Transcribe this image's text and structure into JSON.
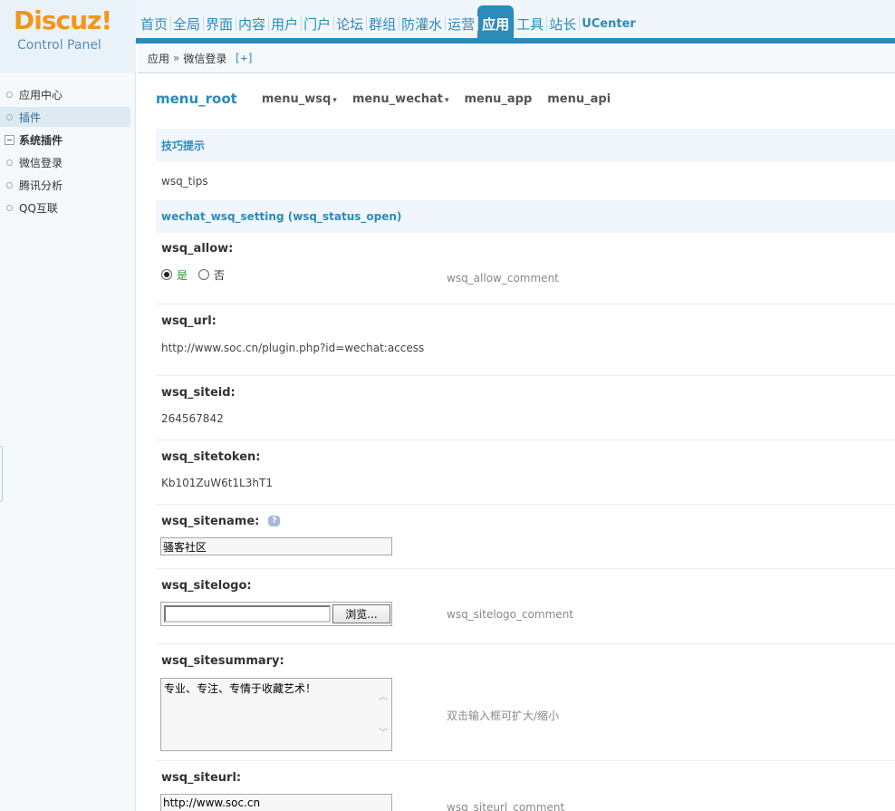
{
  "logo": {
    "brand": "Discuz!",
    "subtitle": "Control Panel"
  },
  "topnav": [
    {
      "label": "首页"
    },
    {
      "label": "全局"
    },
    {
      "label": "界面"
    },
    {
      "label": "内容"
    },
    {
      "label": "用户"
    },
    {
      "label": "门户"
    },
    {
      "label": "论坛"
    },
    {
      "label": "群组"
    },
    {
      "label": "防灌水"
    },
    {
      "label": "运营"
    },
    {
      "label": "应用",
      "active": true
    },
    {
      "label": "工具"
    },
    {
      "label": "站长"
    },
    {
      "label": "UCenter"
    }
  ],
  "breadcrumb": {
    "root": "应用",
    "sep": "»",
    "current": "微信登录",
    "plus": "[+]"
  },
  "sidebar": {
    "items": [
      {
        "label": "应用中心"
      },
      {
        "label": "插件",
        "selected": true
      }
    ],
    "group": "系统插件",
    "group_items": [
      {
        "label": "微信登录"
      },
      {
        "label": "腾讯分析"
      },
      {
        "label": "QQ互联"
      }
    ]
  },
  "submenu": {
    "root": "menu_root",
    "items": [
      {
        "label": "menu_wsq",
        "dropdown": "▾"
      },
      {
        "label": "menu_wechat",
        "dropdown": "▾"
      },
      {
        "label": "menu_app"
      },
      {
        "label": "menu_api"
      }
    ]
  },
  "tips": {
    "title": "技巧提示",
    "text": "wsq_tips"
  },
  "settings": {
    "title": "wechat_wsq_setting (wsq_status_open)",
    "wsq_allow": {
      "label": "wsq_allow:",
      "yes": "是",
      "no": "否",
      "selected": "是",
      "comment": "wsq_allow_comment"
    },
    "wsq_url": {
      "label": "wsq_url:",
      "value": "http://www.soc.cn/plugin.php?id=wechat:access"
    },
    "wsq_siteid": {
      "label": "wsq_siteid:",
      "value": "264567842"
    },
    "wsq_sitetoken": {
      "label": "wsq_sitetoken:",
      "value": "Kb101ZuW6t1L3hT1"
    },
    "wsq_sitename": {
      "label": "wsq_sitename:",
      "value": "骚客社区",
      "help_icon": "question-icon"
    },
    "wsq_sitelogo": {
      "label": "wsq_sitelogo:",
      "browse": "浏览...",
      "comment": "wsq_sitelogo_comment"
    },
    "wsq_sitesummary": {
      "label": "wsq_sitesummary:",
      "value": "专业、专注、专情于收藏艺术！",
      "comment": "双击输入框可扩大/缩小"
    },
    "wsq_siteurl": {
      "label": "wsq_siteurl:",
      "value": "http://www.soc.cn",
      "comment": "wsq_siteurl_comment"
    }
  },
  "colors": {
    "accent": "#2b8bbb",
    "logo": "#f3961c",
    "yes_green": "#1ea21e"
  }
}
